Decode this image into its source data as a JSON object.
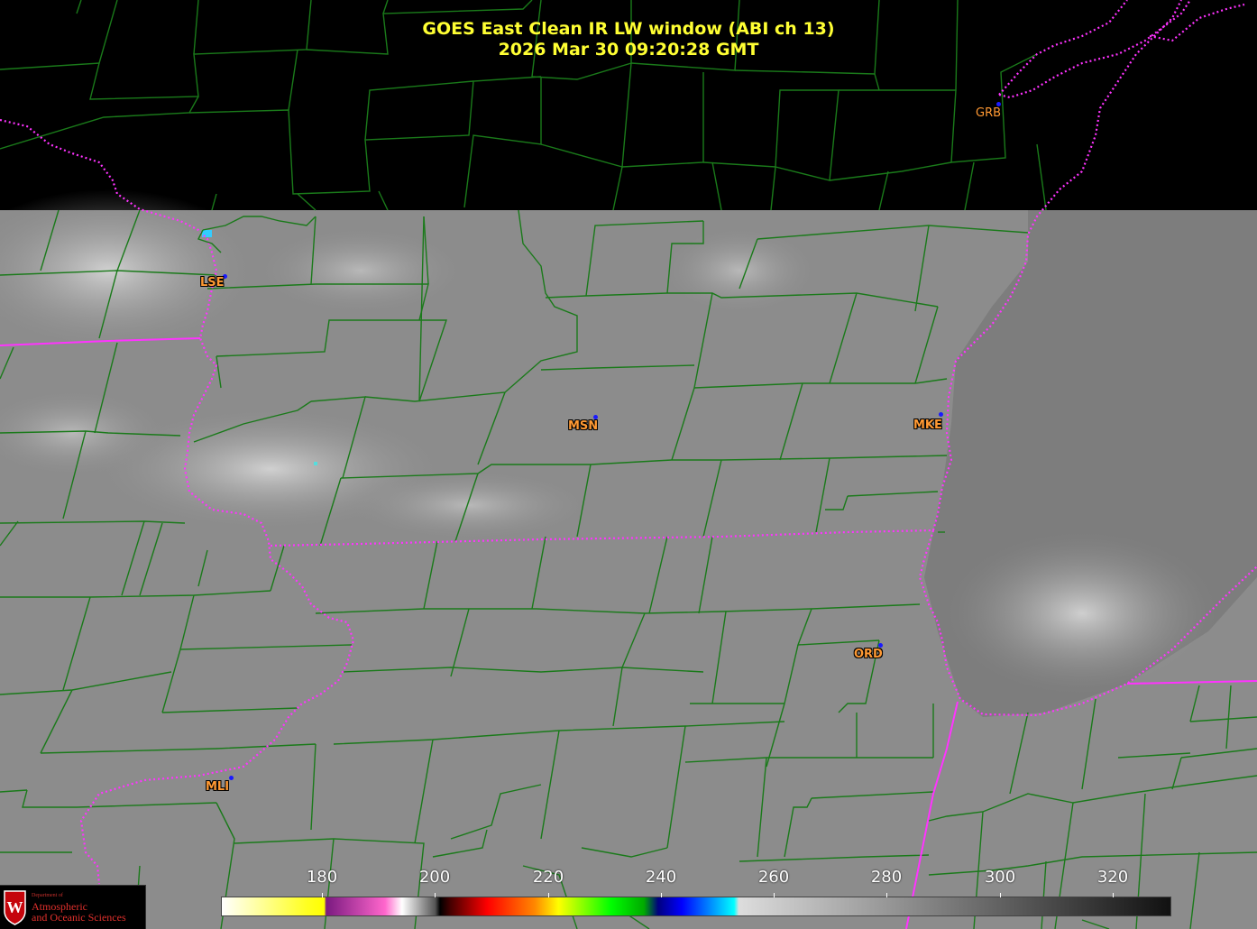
{
  "header": {
    "title_line1": "GOES East Clean IR LW window (ABI ch 13)",
    "title_line2": "2026 Mar 30  09:20:28 GMT"
  },
  "stations": [
    {
      "id": "GRB",
      "label": "GRB"
    },
    {
      "id": "LSE",
      "label": "LSE"
    },
    {
      "id": "MSN",
      "label": "MSN"
    },
    {
      "id": "MKE",
      "label": "MKE"
    },
    {
      "id": "ORD",
      "label": "ORD"
    },
    {
      "id": "MLI",
      "label": "MLI"
    }
  ],
  "colorbar": {
    "ticks": [
      "180",
      "200",
      "220",
      "240",
      "260",
      "280",
      "300",
      "320"
    ]
  },
  "logo": {
    "dept": "Department of",
    "line1": "Atmospheric",
    "line2": "and Oceanic Sciences",
    "shield": "W"
  },
  "colors": {
    "title": "#ffff33",
    "county_lines": "#1a7a1a",
    "state_lines": "#ff33ff",
    "station_labels": "#ff9933",
    "station_dots": "#1a1aff"
  }
}
